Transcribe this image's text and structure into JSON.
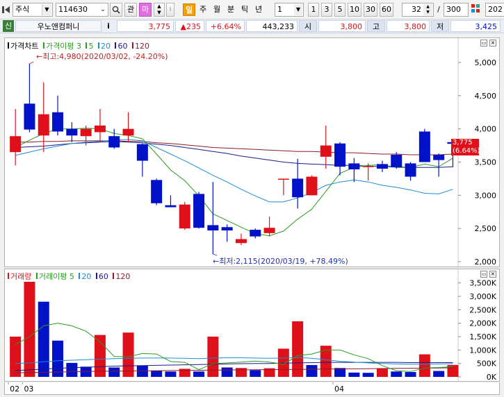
{
  "toolbar": {
    "market": "주식",
    "code": "114630",
    "btn_gwan": "관",
    "btn_ma": "마",
    "period_active": "일",
    "periods": [
      "주",
      "월",
      "분",
      "틱",
      "년"
    ],
    "unit_value": "1",
    "quick_units": [
      "1",
      "3",
      "5",
      "10",
      "30",
      "60"
    ],
    "count_value": "32",
    "slash": "/",
    "total_value": "300",
    "date_value": "202"
  },
  "infobar": {
    "tag": "신",
    "name": "우노앤컴퍼니",
    "info": "i",
    "price": "3,775",
    "change": "▲235",
    "change_pct": "+6.64%",
    "volume": "443,233",
    "open_label": "시",
    "open": "3,800",
    "high_label": "고",
    "high": "3,800",
    "low_label": "저",
    "low": "3,425"
  },
  "colors": {
    "up": "#e0101a",
    "down": "#0012c8",
    "ma5": "#2a9c1e",
    "ma20": "#1e8ad6",
    "ma60": "#1a1a8c",
    "ma120": "#8c1a2a"
  },
  "chart_data": [
    {
      "type": "candlestick",
      "legend": {
        "title": "가격차트",
        "ma_label": "가격이평 3",
        "periods": [
          "5",
          "20",
          "60",
          "120"
        ]
      },
      "x_labels": [
        {
          "index": 0,
          "label": "02"
        },
        {
          "index": 1,
          "label": "03"
        },
        {
          "index": 23,
          "label": "04"
        }
      ],
      "ylim": [
        2000,
        5300
      ],
      "y_ticks": [
        2000,
        2500,
        3000,
        3500,
        4000,
        4500,
        5000
      ],
      "y_tick_labels": [
        "2,000",
        "2,500",
        "3,000",
        "3,500",
        "4,000",
        "4,500",
        "5,000"
      ],
      "candles": [
        {
          "o": 3650,
          "h": 4300,
          "l": 3450,
          "c": 3890
        },
        {
          "o": 4380,
          "h": 4980,
          "l": 3950,
          "c": 3990
        },
        {
          "o": 3900,
          "h": 4700,
          "l": 3650,
          "c": 4220
        },
        {
          "o": 4250,
          "h": 4500,
          "l": 3900,
          "c": 3960
        },
        {
          "o": 4000,
          "h": 4100,
          "l": 3800,
          "c": 3900
        },
        {
          "o": 3890,
          "h": 4050,
          "l": 3750,
          "c": 4000
        },
        {
          "o": 3950,
          "h": 4300,
          "l": 3800,
          "c": 4050
        },
        {
          "o": 3890,
          "h": 4000,
          "l": 3700,
          "c": 3720
        },
        {
          "o": 3900,
          "h": 4250,
          "l": 3800,
          "c": 4000
        },
        {
          "o": 3770,
          "h": 3780,
          "l": 3280,
          "c": 3520
        },
        {
          "o": 3230,
          "h": 3250,
          "l": 2850,
          "c": 2880
        },
        {
          "o": 2850,
          "h": 3000,
          "l": 2820,
          "c": 2820
        },
        {
          "o": 2500,
          "h": 2900,
          "l": 2480,
          "c": 2860
        },
        {
          "o": 3020,
          "h": 3050,
          "l": 2500,
          "c": 2510
        },
        {
          "o": 2550,
          "h": 3200,
          "l": 2115,
          "c": 2470
        },
        {
          "o": 2520,
          "h": 2560,
          "l": 2300,
          "c": 2470
        },
        {
          "o": 2280,
          "h": 2420,
          "l": 2250,
          "c": 2340
        },
        {
          "o": 2480,
          "h": 2500,
          "l": 2350,
          "c": 2380
        },
        {
          "o": 2430,
          "h": 2680,
          "l": 2380,
          "c": 2510
        },
        {
          "o": 3250,
          "h": 3250,
          "l": 3000,
          "c": 3250
        },
        {
          "o": 3250,
          "h": 3550,
          "l": 2800,
          "c": 2970
        },
        {
          "o": 3000,
          "h": 3300,
          "l": 3000,
          "c": 3280
        },
        {
          "o": 3580,
          "h": 4050,
          "l": 3400,
          "c": 3750
        },
        {
          "o": 3780,
          "h": 3800,
          "l": 3300,
          "c": 3430
        },
        {
          "o": 3480,
          "h": 3560,
          "l": 3200,
          "c": 3390
        },
        {
          "o": 3430,
          "h": 3480,
          "l": 3220,
          "c": 3440
        },
        {
          "o": 3470,
          "h": 3520,
          "l": 3350,
          "c": 3400
        },
        {
          "o": 3610,
          "h": 3650,
          "l": 3400,
          "c": 3420
        },
        {
          "o": 3480,
          "h": 3500,
          "l": 3220,
          "c": 3280
        },
        {
          "o": 3960,
          "h": 4000,
          "l": 3500,
          "c": 3500
        },
        {
          "o": 3610,
          "h": 3630,
          "l": 3280,
          "c": 3530
        },
        {
          "o": 3800,
          "h": 3800,
          "l": 3425,
          "c": 3775
        }
      ],
      "ma5": [
        3720,
        3830,
        3930,
        4000,
        4000,
        4010,
        4000,
        3930,
        3900,
        3850,
        3620,
        3380,
        3220,
        2990,
        2720,
        2620,
        2520,
        2420,
        2390,
        2460,
        2640,
        2790,
        3060,
        3330,
        3420,
        3450,
        3460,
        3420,
        3420,
        3470,
        3430,
        3560
      ],
      "ma20": [
        3600,
        3650,
        3700,
        3740,
        3780,
        3800,
        3810,
        3830,
        3840,
        3820,
        3720,
        3620,
        3520,
        3410,
        3300,
        3200,
        3090,
        2990,
        2900,
        2900,
        2960,
        3040,
        3150,
        3200,
        3230,
        3200,
        3150,
        3120,
        3080,
        3030,
        3020,
        3090
      ],
      "ma60": [
        3720,
        3730,
        3740,
        3760,
        3780,
        3790,
        3800,
        3810,
        3800,
        3790,
        3770,
        3750,
        3720,
        3690,
        3660,
        3630,
        3590,
        3560,
        3530,
        3500,
        3480,
        3470,
        3460,
        3450,
        3450,
        3440,
        3430,
        3430,
        3420,
        3420,
        3420,
        3430
      ],
      "ma120": [
        3800,
        3800,
        3810,
        3810,
        3820,
        3820,
        3820,
        3820,
        3810,
        3810,
        3790,
        3780,
        3760,
        3740,
        3720,
        3710,
        3700,
        3690,
        3680,
        3670,
        3660,
        3660,
        3650,
        3640,
        3640,
        3630,
        3620,
        3620,
        3610,
        3610,
        3610,
        3620
      ],
      "annotations": {
        "high_text": "←최고:4,980(2020/03/02, -24.20%)",
        "low_text": "←최저:2,115(2020/03/19, +78.49%)",
        "high_index": 1,
        "high_value": 4980,
        "low_index": 14,
        "low_value": 2115
      },
      "last_price_label": "3,775",
      "last_pct_label": "(6.64%)"
    },
    {
      "type": "bar",
      "legend": {
        "title": "거래량",
        "ma_label": "거래이평 5",
        "periods": [
          "20",
          "60",
          "120"
        ]
      },
      "ylim": [
        0,
        3800000
      ],
      "y_ticks": [
        0,
        500000,
        1000000,
        1500000,
        2000000,
        2500000,
        3000000,
        3500000
      ],
      "y_tick_labels": [
        "0K",
        "500K",
        "1,000K",
        "1,500K",
        "2,000K",
        "2,500K",
        "3,000K",
        "3,500K"
      ],
      "values": [
        1500000,
        3900000,
        2800000,
        1350000,
        520000,
        380000,
        1560000,
        350000,
        1650000,
        420000,
        230000,
        200000,
        300000,
        200000,
        1500000,
        350000,
        330000,
        250000,
        320000,
        1050000,
        2070000,
        440000,
        1160000,
        330000,
        160000,
        150000,
        320000,
        200000,
        180000,
        840000,
        220000,
        443233
      ],
      "ma5": [
        1200000,
        1500000,
        1900000,
        2000000,
        1900000,
        1700000,
        1300000,
        760000,
        750000,
        870000,
        850000,
        570000,
        540000,
        270000,
        490000,
        520000,
        550000,
        590000,
        550000,
        470000,
        790000,
        850000,
        1000000,
        1000000,
        820000,
        680000,
        420000,
        230000,
        200000,
        330000,
        350000,
        380000
      ],
      "ma20": [
        500000,
        520000,
        560000,
        600000,
        620000,
        640000,
        660000,
        680000,
        690000,
        700000,
        700000,
        700000,
        690000,
        680000,
        700000,
        710000,
        710000,
        700000,
        690000,
        700000,
        720000,
        690000,
        640000,
        580000,
        550000,
        520000,
        500000,
        480000,
        470000,
        470000,
        480000,
        490000
      ],
      "ma60": [
        240000,
        260000,
        290000,
        320000,
        340000,
        360000,
        380000,
        400000,
        410000,
        420000,
        430000,
        440000,
        450000,
        460000,
        470000,
        480000,
        490000,
        500000,
        500000,
        510000,
        520000,
        530000,
        540000,
        540000,
        540000,
        540000,
        540000,
        540000,
        530000,
        530000,
        530000,
        530000
      ],
      "ma120": [
        150000,
        160000,
        170000,
        180000,
        190000,
        200000,
        210000,
        215000,
        220000,
        225000,
        230000,
        235000,
        240000,
        245000,
        250000,
        255000,
        260000,
        265000,
        270000,
        275000,
        280000,
        285000,
        290000,
        295000,
        300000,
        305000,
        310000,
        315000,
        320000,
        325000,
        330000,
        335000
      ],
      "direction": [
        "up",
        "up",
        "down",
        "down",
        "down",
        "down",
        "up",
        "down",
        "up",
        "down",
        "down",
        "down",
        "up",
        "down",
        "up",
        "down",
        "up",
        "down",
        "up",
        "up",
        "up",
        "down",
        "up",
        "down",
        "down",
        "down",
        "up",
        "down",
        "down",
        "up",
        "down",
        "up"
      ]
    }
  ]
}
